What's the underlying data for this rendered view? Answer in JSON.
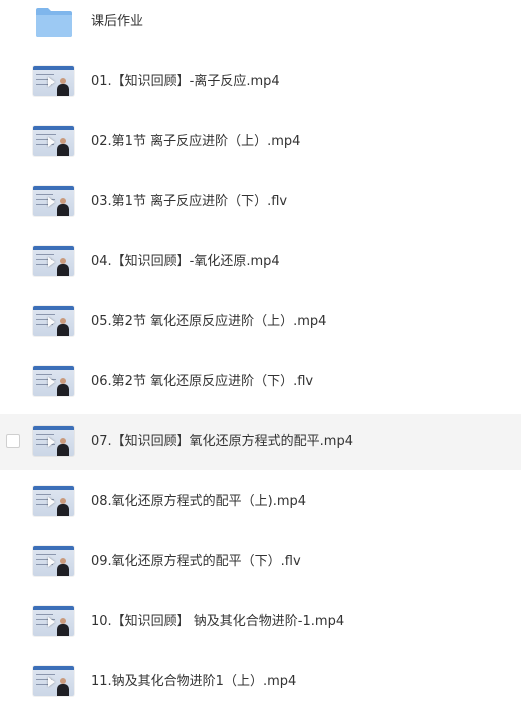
{
  "folder": {
    "name": "课后作业",
    "icon": "folder-icon"
  },
  "files": [
    {
      "name": "01.【知识回顾】-离子反应.mp4"
    },
    {
      "name": "02.第1节 离子反应进阶（上）.mp4"
    },
    {
      "name": "03.第1节 离子反应进阶（下）.flv"
    },
    {
      "name": "04.【知识回顾】-氧化还原.mp4"
    },
    {
      "name": "05.第2节 氧化还原反应进阶（上）.mp4"
    },
    {
      "name": "06.第2节 氧化还原反应进阶（下）.flv"
    },
    {
      "name": "07.【知识回顾】氧化还原方程式的配平.mp4",
      "hovered": true
    },
    {
      "name": "08.氧化还原方程式的配平（上).mp4"
    },
    {
      "name": "09.氧化还原方程式的配平（下）.flv"
    },
    {
      "name": "10.【知识回顾】 钠及其化合物进阶-1.mp4"
    },
    {
      "name": "11.钠及其化合物进阶1（上）.mp4"
    }
  ],
  "colors": {
    "folder": "#8dbff0",
    "hover_row": "#f4f4f4",
    "text": "#333333"
  }
}
